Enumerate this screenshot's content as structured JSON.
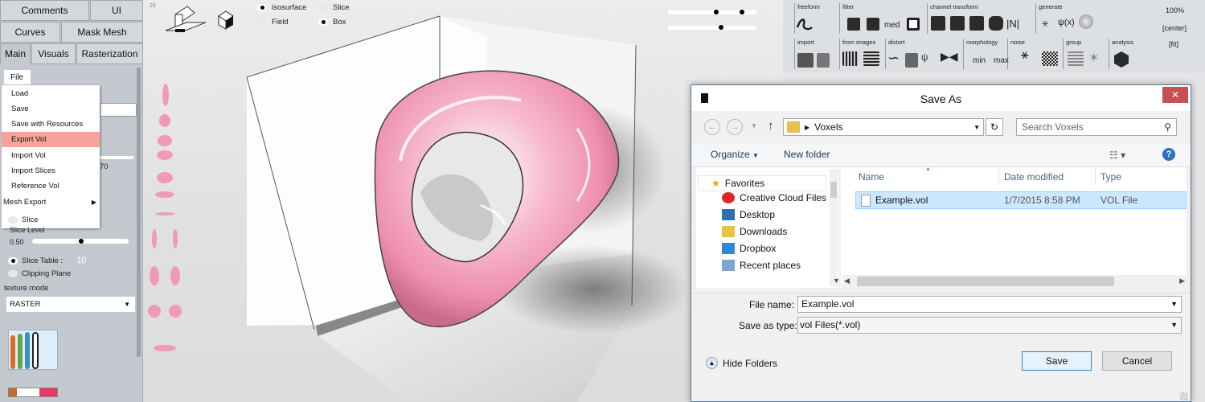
{
  "left_panel": {
    "top_tabs": [
      "Comments",
      "UI",
      "Curves",
      "Mask Mesh",
      "Main",
      "Visuals",
      "Rasterization"
    ],
    "file_menu_label": "File",
    "file_menu_items": [
      "Load",
      "Save",
      "Save with Resources",
      "Export Vol",
      "Import Vol",
      "Import Slices",
      "Reference Vol",
      "Mesh Export"
    ],
    "hidden_value": "70",
    "slice_label": "Slice",
    "slice_level_label": "Slice Level",
    "slice_level_value": "0.50",
    "slice_table_label": "Slice Table :",
    "slice_table_value": "10",
    "clipping_label": "Clipping Plane",
    "texture_mode_label": "texture mode",
    "texture_mode_value": "RASTER"
  },
  "viewport": {
    "counter": "29",
    "view_options": [
      "isosurface",
      "Slice",
      "Field",
      "Box"
    ],
    "selected_options": [
      "isosurface",
      "Box"
    ]
  },
  "toolbar": {
    "groups": [
      "freeform",
      "filter",
      "channel transform",
      "generate",
      "import",
      "from images",
      "distort",
      "morphology",
      "noise",
      "group",
      "analysis"
    ],
    "icon_labels": {
      "med": "med",
      "min": "min",
      "max": "max",
      "norm": "|N|",
      "psi": "ψ(x)"
    },
    "zoom": "100%",
    "center": "[center]",
    "fit": "[fit]"
  },
  "dialog": {
    "title": "Save As",
    "path": "Voxels",
    "search_placeholder": "Search Voxels",
    "organize": "Organize",
    "new_folder": "New folder",
    "nav_header": "Favorites",
    "nav_items": [
      "Creative Cloud Files",
      "Desktop",
      "Downloads",
      "Dropbox",
      "Recent places"
    ],
    "columns": [
      "Name",
      "Date modified",
      "Type"
    ],
    "files": [
      {
        "name": "Example.vol",
        "date": "1/7/2015 8:58 PM",
        "type": "VOL File"
      }
    ],
    "file_name_label": "File name:",
    "file_name_value": "Example.vol",
    "save_as_type_label": "Save as type:",
    "save_as_type_value": "vol Files(*.vol)",
    "hide_folders": "Hide Folders",
    "save_button": "Save",
    "cancel_button": "Cancel",
    "close_glyph": "✕"
  },
  "colors": {
    "accent_pink": "#f4a7c0",
    "menu_highlight": "#f7a39a",
    "selection": "#cce8ff"
  }
}
